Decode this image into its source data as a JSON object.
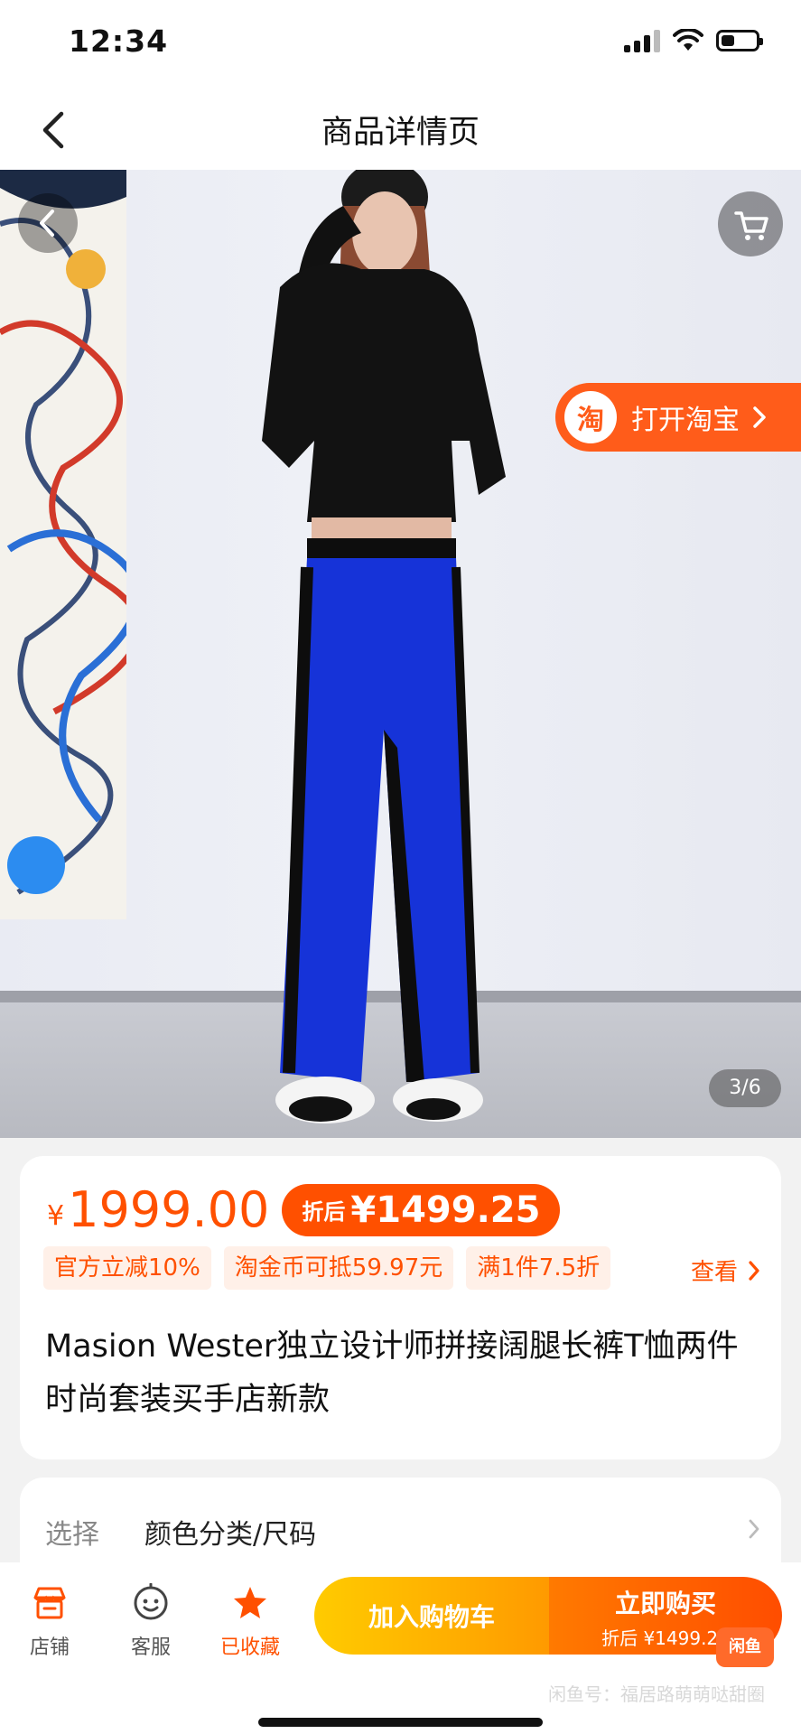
{
  "status_bar": {
    "time": "12:34"
  },
  "nav": {
    "title": "商品详情页"
  },
  "hero": {
    "open_taobao_label": "打开淘宝",
    "taobao_logo_char": "淘",
    "page_indicator": "3/6"
  },
  "price": {
    "currency_symbol": "¥",
    "original": "1999.00",
    "discount_label": "折后",
    "discount_price": "¥1499.25"
  },
  "promo_tags": [
    "官方立减10%",
    "淘金币可抵59.97元",
    "满1件7.5折"
  ],
  "see_more_label": "查看",
  "product_title": "Masion Wester独立设计师拼接阔腿长裤T恤两件时尚套装买手店新款",
  "spec": {
    "label": "选择",
    "value": "颜色分类/尺码"
  },
  "bottom_bar": {
    "store_label": "店铺",
    "service_label": "客服",
    "favorited_label": "已收藏",
    "add_to_cart_label": "加入购物车",
    "buy_now_label": "立即购买",
    "buy_now_sub": "折后 ¥1499.25",
    "badge_text": "闲鱼",
    "watermark": "闲鱼号：福居路萌萌哒甜圈"
  },
  "colors": {
    "accent": "#ff5000",
    "taobao_orange": "#ff5c1a",
    "cart_yellow": "#ffcb00",
    "tag_bg": "#fff0e8",
    "page_bg": "#f2f2f2"
  },
  "icons": [
    "back-chevron-icon",
    "cart-icon",
    "taobao-logo-icon",
    "chevron-right-icon",
    "store-icon",
    "customer-service-icon",
    "star-icon"
  ]
}
